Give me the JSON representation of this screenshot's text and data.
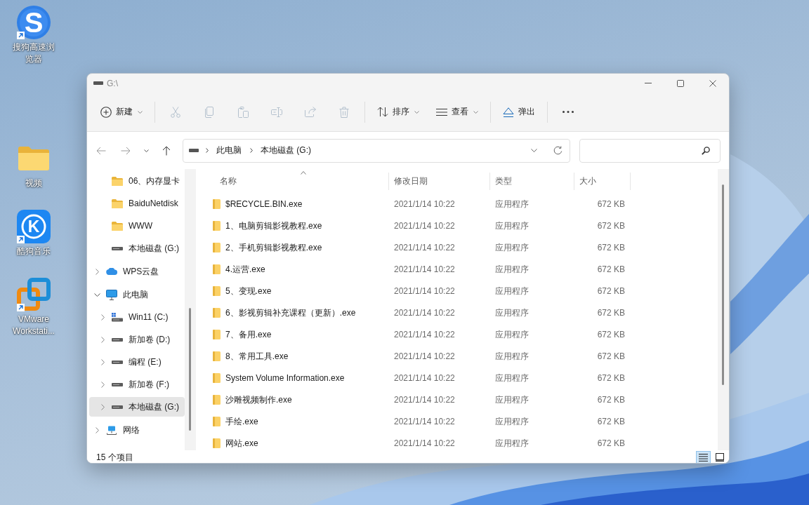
{
  "desktop": {
    "icons": [
      {
        "kind": "sogou",
        "letter": "S",
        "label": "搜狗高速浏览器",
        "shortcut": true
      },
      {
        "kind": "folder",
        "label": "视频",
        "shortcut": false
      },
      {
        "kind": "kugou",
        "letter": "K",
        "label": "酷狗音乐",
        "shortcut": true
      },
      {
        "kind": "vmware",
        "label": "VMware Workstati...",
        "shortcut": true
      }
    ]
  },
  "window": {
    "title": "G:\\",
    "toolbar": [
      {
        "buttons": [
          {
            "kind": "new",
            "label": "新建",
            "dropdown": true,
            "disabled": false
          }
        ]
      },
      {
        "buttons": [
          {
            "kind": "cut",
            "dropdown": false,
            "disabled": true
          },
          {
            "kind": "copy",
            "dropdown": false,
            "disabled": true
          },
          {
            "kind": "paste",
            "dropdown": false,
            "disabled": true
          },
          {
            "kind": "rename",
            "dropdown": false,
            "disabled": true
          },
          {
            "kind": "share",
            "dropdown": false,
            "disabled": true
          },
          {
            "kind": "delete",
            "dropdown": false,
            "disabled": true
          }
        ]
      },
      {
        "buttons": [
          {
            "kind": "sort",
            "label": "排序",
            "dropdown": true,
            "disabled": false
          },
          {
            "kind": "view",
            "label": "查看",
            "dropdown": true,
            "disabled": false
          }
        ]
      },
      {
        "buttons": [
          {
            "kind": "eject",
            "label": "弹出",
            "dropdown": false,
            "disabled": false
          }
        ]
      },
      {
        "buttons": [
          {
            "kind": "more",
            "dropdown": false,
            "disabled": false
          }
        ]
      }
    ],
    "nav": [
      {
        "kind": "back",
        "disabled": true
      },
      {
        "kind": "forward",
        "disabled": true
      },
      {
        "kind": "recent",
        "disabled": false
      },
      {
        "kind": "up",
        "disabled": false
      }
    ],
    "address": {
      "crumbs": [
        "此电脑",
        "本地磁盘 (G:)"
      ]
    },
    "sidebar": {
      "items": [
        {
          "children": [
            {
              "kind": "folder",
              "label": "06、内存显卡",
              "selected": false
            },
            {
              "kind": "folder",
              "label": "BaiduNetdisk",
              "selected": false
            },
            {
              "kind": "folder",
              "label": "WWW",
              "selected": false
            },
            {
              "kind": "drive",
              "label": "本地磁盘 (G:)",
              "selected": false
            }
          ]
        },
        {
          "kind": "cloud",
          "label": "WPS云盘",
          "expanded": false,
          "selected": false
        },
        {
          "kind": "computer",
          "label": "此电脑",
          "expanded": true,
          "selected": false,
          "children": [
            {
              "kind": "system-drive",
              "label": "Win11 (C:)",
              "expanded": false,
              "selected": false
            },
            {
              "kind": "drive",
              "label": "新加卷 (D:)",
              "expanded": false,
              "selected": false
            },
            {
              "kind": "drive",
              "label": "编程 (E:)",
              "expanded": false,
              "selected": false
            },
            {
              "kind": "drive",
              "label": "新加卷 (F:)",
              "expanded": false,
              "selected": false
            },
            {
              "kind": "drive",
              "label": "本地磁盘 (G:)",
              "expanded": false,
              "selected": true
            }
          ]
        },
        {
          "kind": "network",
          "label": "网络",
          "expanded": false,
          "selected": false
        }
      ]
    },
    "table": {
      "columns": [
        {
          "label": "名称",
          "sorted": true
        },
        {
          "label": "修改日期",
          "sorted": false
        },
        {
          "label": "类型",
          "sorted": false
        },
        {
          "label": "大小",
          "sorted": false
        }
      ],
      "rows": [
        {
          "name": "$RECYCLE.BIN.exe",
          "date": "2021/1/14 10:22",
          "type": "应用程序",
          "size": "672 KB"
        },
        {
          "name": "1、电脑剪辑影视教程.exe",
          "date": "2021/1/14 10:22",
          "type": "应用程序",
          "size": "672 KB"
        },
        {
          "name": "2、手机剪辑影视教程.exe",
          "date": "2021/1/14 10:22",
          "type": "应用程序",
          "size": "672 KB"
        },
        {
          "name": "4.运营.exe",
          "date": "2021/1/14 10:22",
          "type": "应用程序",
          "size": "672 KB"
        },
        {
          "name": "5、变现.exe",
          "date": "2021/1/14 10:22",
          "type": "应用程序",
          "size": "672 KB"
        },
        {
          "name": "6、影视剪辑补充课程（更新）.exe",
          "date": "2021/1/14 10:22",
          "type": "应用程序",
          "size": "672 KB"
        },
        {
          "name": "7、备用.exe",
          "date": "2021/1/14 10:22",
          "type": "应用程序",
          "size": "672 KB"
        },
        {
          "name": "8、常用工具.exe",
          "date": "2021/1/14 10:22",
          "type": "应用程序",
          "size": "672 KB"
        },
        {
          "name": "System Volume Information.exe",
          "date": "2021/1/14 10:22",
          "type": "应用程序",
          "size": "672 KB"
        },
        {
          "name": "沙雕视频制作.exe",
          "date": "2021/1/14 10:22",
          "type": "应用程序",
          "size": "672 KB"
        },
        {
          "name": "手绘.exe",
          "date": "2021/1/14 10:22",
          "type": "应用程序",
          "size": "672 KB"
        },
        {
          "name": "网站.exe",
          "date": "2021/1/14 10:22",
          "type": "应用程序",
          "size": "672 KB"
        }
      ]
    },
    "status_bar": {
      "item_count": "15 个项目",
      "views": [
        {
          "kind": "details",
          "selected": true
        },
        {
          "kind": "tiles",
          "selected": false
        }
      ]
    }
  }
}
